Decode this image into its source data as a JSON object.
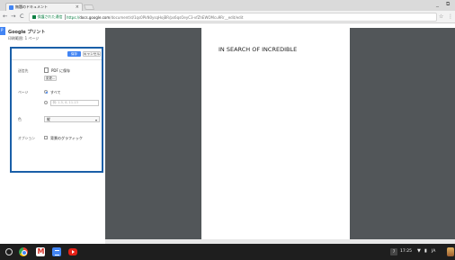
{
  "browser": {
    "tab_title": "無題のドキュメント",
    "tab_close": "×",
    "window_controls": [
      "_",
      "⧉"
    ],
    "nav": {
      "back": "←",
      "forward": "→",
      "reload": "C"
    },
    "address": {
      "secure_label": "保護された通信",
      "scheme": "https://",
      "host": "docs.google.com",
      "path": "/document/d/1qs0PkN0ysqHojBR/ps6qsOeyC3-vfZhEWOMcu9Rr__edit/edit"
    },
    "star": "☆",
    "menu": "⋮"
  },
  "print_dialog": {
    "strip_label": "P",
    "title": "Google プリント",
    "pages_summary": "印刷範囲: 1 ページ",
    "print_button": "保存",
    "cancel_button": "キャンセル",
    "destination_label": "送信先",
    "destination_name": "PDF に保存",
    "change_button": "変更...",
    "pages_label": "ページ",
    "pages_all": "すべて",
    "pages_custom_placeholder": "例: 1-5, 8, 11-13",
    "layout_label": "色",
    "layout_value": "縦",
    "options_label": "オプション",
    "background_graphics": "背景のグラフィック"
  },
  "preview": {
    "page_text": "IN SEARCH OF INCREDIBLE"
  },
  "taskbar": {
    "notifications": "7",
    "time": "17:25",
    "wifi_icon": "wifi-icon",
    "battery_icon": "battery-icon",
    "lang": "JA"
  }
}
